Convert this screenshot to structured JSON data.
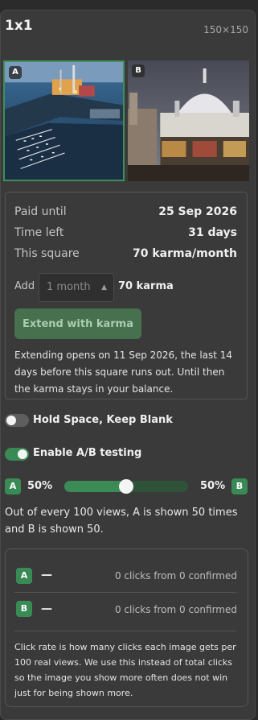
{
  "header": {
    "title": "1x1",
    "size": "150×150"
  },
  "images": [
    {
      "badge": "A",
      "desc_icon": "harbor-photo-icon"
    },
    {
      "badge": "B",
      "desc_icon": "domed-building-photo-icon"
    }
  ],
  "billing": {
    "rows": [
      {
        "label": "Paid until",
        "value": "25 Sep 2026"
      },
      {
        "label": "Time left",
        "value": "31 days"
      },
      {
        "label": "This square",
        "value": "70 karma/month"
      }
    ],
    "add_label": "Add",
    "duration_placeholder": "1 month",
    "add_cost": "70 karma",
    "extend_button": "Extend with karma",
    "note": "Extending opens on 11 Sep 2026, the last 14 days before this square runs out. Until then the karma stays in your balance."
  },
  "toggles": {
    "hold_space": {
      "label": "Hold Space, Keep Blank",
      "on": false
    },
    "ab_testing": {
      "label": "Enable A/B testing",
      "on": true
    }
  },
  "ab_split": {
    "a_label": "A",
    "b_label": "B",
    "a_percent": "50%",
    "b_percent": "50%",
    "a_share": 0.5,
    "description": "Out of every 100 views, A is shown 50 times and B is shown 50."
  },
  "stats": {
    "rows": [
      {
        "label": "A",
        "rate": "—",
        "clicks": "0 clicks from 0 confirmed"
      },
      {
        "label": "B",
        "rate": "—",
        "clicks": "0 clicks from 0 confirmed"
      }
    ],
    "note": "Click rate is how many clicks each image gets per 100 real views. We use this instead of total clicks so the image you show more often does not win just for being shown more."
  },
  "colors": {
    "accent_green": "#3a8a55",
    "panel_bg": "#3a3a3a",
    "page_bg": "#2b2b2b"
  }
}
